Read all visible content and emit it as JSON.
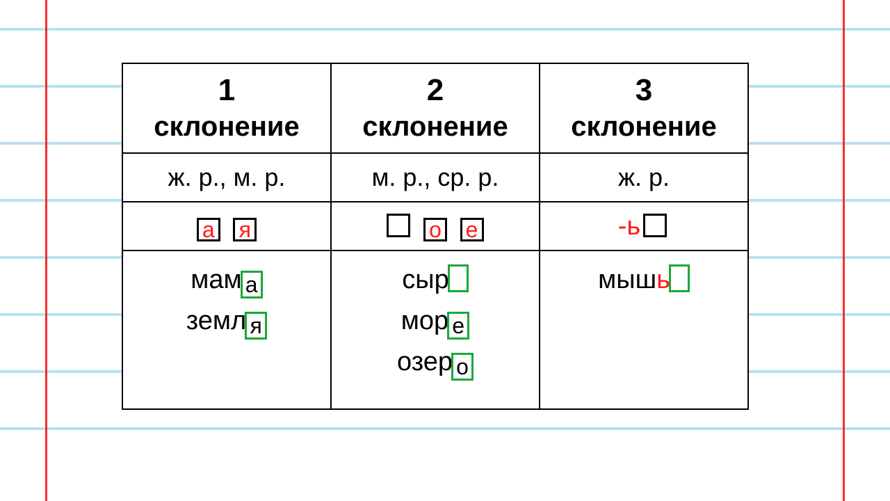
{
  "columns": [
    {
      "num": "1",
      "label": "склонение",
      "gender": "ж. р., м. р."
    },
    {
      "num": "2",
      "label": "склонение",
      "gender": "м. р., ср. р."
    },
    {
      "num": "3",
      "label": "склонение",
      "gender": "ж. р."
    }
  ],
  "endings": {
    "col1": {
      "a": "а",
      "ya": "я"
    },
    "col2": {
      "o": "о",
      "e": "е"
    },
    "col3": {
      "soft": "-ь"
    }
  },
  "examples": {
    "col1": [
      {
        "stem": "мам",
        "end": "а"
      },
      {
        "stem": "земл",
        "end": "я"
      }
    ],
    "col2": [
      {
        "stem": "сыр",
        "end": ""
      },
      {
        "stem": "мор",
        "end": "е"
      },
      {
        "stem": "озер",
        "end": "о"
      }
    ],
    "col3": [
      {
        "stem": "мыш",
        "soft": "ь",
        "end": ""
      }
    ]
  }
}
